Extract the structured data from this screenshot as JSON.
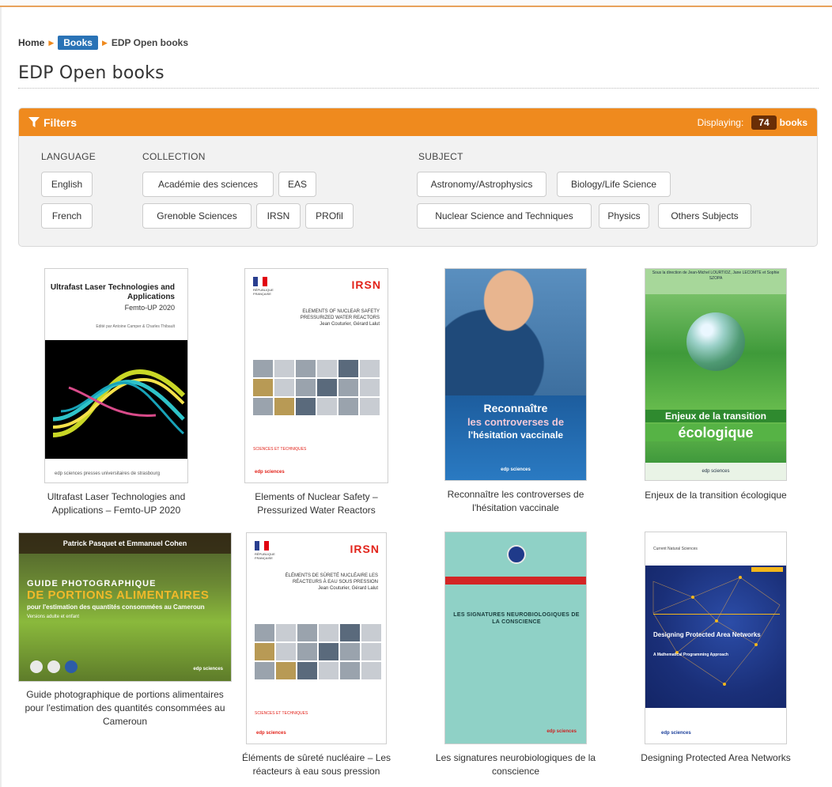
{
  "breadcrumb": {
    "home": "Home",
    "section": "Books",
    "current": "EDP Open books"
  },
  "page_title": "EDP Open books",
  "filters": {
    "title": "Filters",
    "displaying_label": "Displaying:",
    "count": "74",
    "count_unit": "books",
    "language": {
      "label": "LANGUAGE",
      "options": [
        "English",
        "French"
      ]
    },
    "collection": {
      "label": "COLLECTION",
      "options": [
        "Académie des sciences",
        "EAS",
        "Grenoble Sciences",
        "IRSN",
        "PROfil"
      ]
    },
    "subject": {
      "label": "SUBJECT",
      "options": [
        "Astronomy/Astrophysics",
        "Biology/Life Science",
        "Nuclear Science and Techniques",
        "Physics",
        "Others Subjects"
      ]
    }
  },
  "books": [
    {
      "caption": "Ultrafast Laser Technologies and Applications – Femto-UP 2020",
      "cover": {
        "title": "Ultrafast Laser Technologies and Applications",
        "subtitle": "Femto-UP 2020",
        "editors": "Edité par Antoine Camper & Charles Thibault",
        "footer": "edp sciences   presses universitaires de strasbourg"
      }
    },
    {
      "caption": "Elements of Nuclear Safety – Pressurized Water Reactors",
      "cover": {
        "logo": "IRSN",
        "republic": "RÉPUBLIQUE FRANÇAISE",
        "title": "ELEMENTS OF NUCLEAR SAFETY PRESSURIZED WATER REACTORS",
        "authors": "Jean Couturier, Gérard Lalut",
        "red": "SCIENCES ET TECHNIQUES",
        "edp": "edp sciences"
      }
    },
    {
      "caption": "Reconnaître les controverses de l'hésitation vaccinale",
      "cover": {
        "line1": "Reconnaître",
        "line2": "les controverses de",
        "line3": "l'hésitation vaccinale",
        "edp": "edp sciences"
      }
    },
    {
      "caption": "Enjeux de la transition écologique",
      "cover": {
        "authors": "Sous la direction de Jean-Michel LOURTIOZ, Jane LECOMTE et Sophie SZOPA",
        "line1": "Enjeux de la transition",
        "line2": "écologique",
        "edp": "edp sciences"
      }
    },
    {
      "caption": "Guide photographique de portions alimentaires pour l'estimation des quantités consommées au Cameroun",
      "cover": {
        "authors": "Patrick Pasquet et Emmanuel Cohen",
        "line1": "GUIDE PHOTOGRAPHIQUE",
        "line2": "DE PORTIONS ALIMENTAIRES",
        "line3": "pour l'estimation des quantités consommées au Cameroun",
        "line4": "Versions adulte et enfant",
        "edp": "edp sciences"
      }
    },
    {
      "caption": "Éléments de sûreté nucléaire – Les réacteurs à eau sous pression",
      "cover": {
        "logo": "IRSN",
        "republic": "RÉPUBLIQUE FRANÇAISE",
        "title": "ÉLÉMENTS DE SÛRETÉ NUCLÉAIRE LES RÉACTEURS À EAU SOUS PRESSION",
        "authors": "Jean Couturier, Gérard Lalut",
        "red": "SCIENCES ET TECHNIQUES",
        "edp": "edp sciences"
      }
    },
    {
      "caption": "Les signatures neurobiologiques de la conscience",
      "cover": {
        "title": "LES SIGNATURES NEUROBIOLOGIQUES DE LA CONSCIENCE",
        "edp": "edp sciences"
      }
    },
    {
      "caption": "Designing Protected Area Networks",
      "cover": {
        "series": "Current Natural Sciences",
        "title": "Designing Protected Area Networks",
        "subtitle": "A Mathematical Programming Approach",
        "edp": "edp sciences"
      }
    }
  ]
}
